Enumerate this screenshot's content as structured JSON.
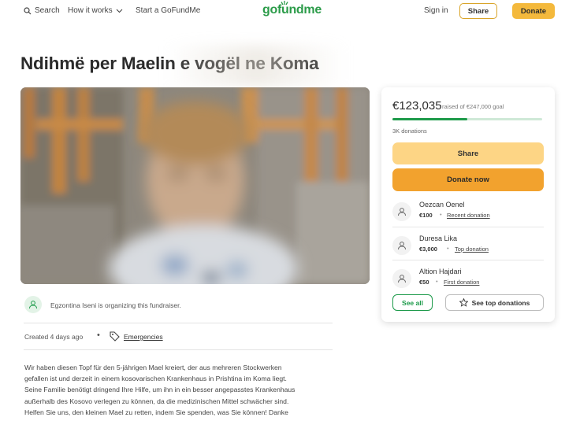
{
  "header": {
    "search_label": "Search",
    "how_it_works_label": "How it works",
    "start_label": "Start a GoFundMe",
    "logo_text": "gofundme",
    "signin_label": "Sign in",
    "share_label": "Share",
    "donate_label": "Donate"
  },
  "campaign": {
    "title": "Ndihmë per Maelin e vogël ne Koma",
    "organizer_text": "Egzontina Iseni is organizing this fundraiser.",
    "created": "Created 4 days ago",
    "category": "Emergencies",
    "story_lines": [
      "Wir haben diesen Topf für den 5-jährigen Mael kreiert, der aus mehreren Stockwerken",
      "gefallen ist und derzeit in einem kosovarischen Krankenhaus in Prishtina im Koma liegt.",
      "Seine Familie benötigt dringend Ihre Hilfe, um ihn in ein besser angepasstes Krankenhaus",
      "außerhalb des Kosovo verlegen zu können, da die medizinischen Mittel schwächer sind.",
      "Helfen Sie uns, den kleinen Mael zu retten, indem Sie spenden, was Sie können! Danke"
    ]
  },
  "donation_card": {
    "raised": "€123,035",
    "goal_text": "raised of €247,000 goal",
    "progress_fraction": 0.4981,
    "donations_count": "3K donations",
    "share_label": "Share",
    "donate_now_label": "Donate now",
    "donors": [
      {
        "name": "Oezcan Oenel",
        "amount": "€100",
        "tag": "Recent donation"
      },
      {
        "name": "Duresa Lika",
        "amount": "€3,000",
        "tag": "Top donation"
      },
      {
        "name": "Altion Hajdari",
        "amount": "€50",
        "tag": "First donation"
      }
    ],
    "see_all_label": "See all",
    "see_top_label": "See top donations"
  },
  "colors": {
    "brand_green": "#1d9a4a",
    "donate_orange": "#f2a22e",
    "share_yellow": "#fdd585"
  },
  "icons": [
    "search-icon",
    "chevron-down-icon",
    "user-icon",
    "tag-icon",
    "star-icon"
  ]
}
